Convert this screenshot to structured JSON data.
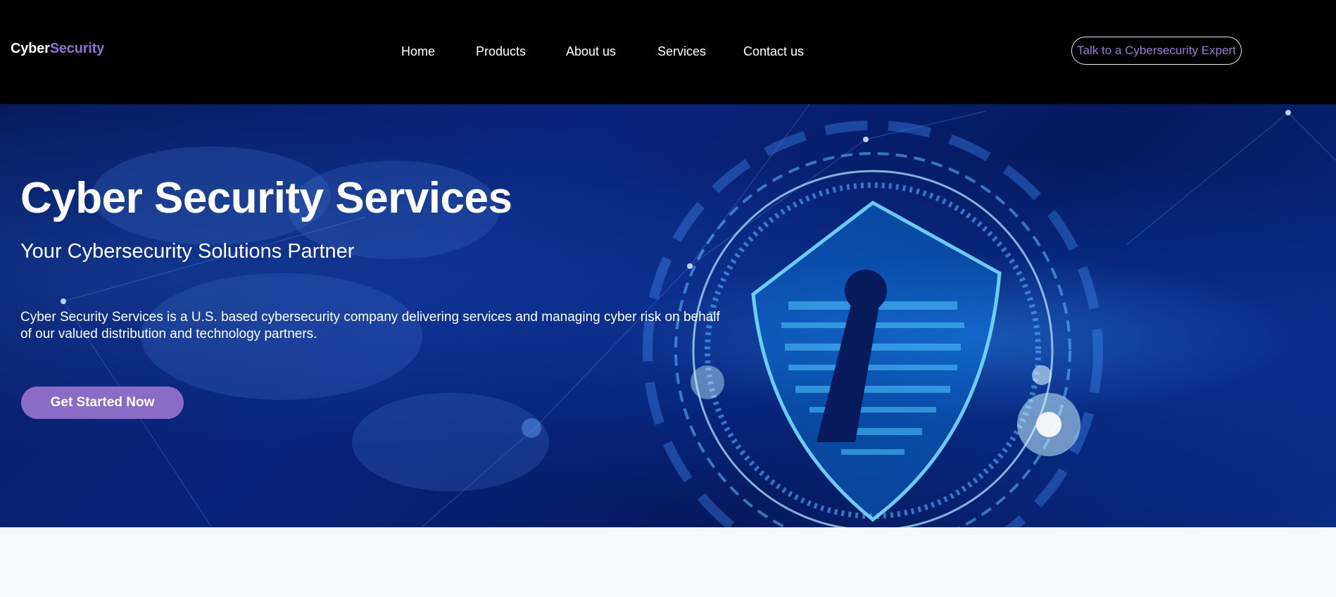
{
  "header": {
    "logo_part1": "Cyber",
    "logo_part2": "Security",
    "nav": [
      {
        "label": "Home"
      },
      {
        "label": "Products"
      },
      {
        "label": "About us"
      },
      {
        "label": "Services"
      },
      {
        "label": "Contact us"
      }
    ],
    "cta_label": "Talk to a Cybersecurity Expert"
  },
  "hero": {
    "title": "Cyber Security Services",
    "subtitle": "Your Cybersecurity Solutions Partner",
    "description": "Cyber Security Services is a U.S. based cybersecurity company delivering services and managing cyber risk on behalf of our valued distribution and technology partners.",
    "button_label": "Get Started Now",
    "image_icon": "shield-keyhole-icon"
  },
  "colors": {
    "accent": "#8a6cc7",
    "logo_accent": "#8f6fd0",
    "header_bg": "#000000",
    "hero_bg": "#08237a",
    "page_bg": "#f8f9fb"
  }
}
